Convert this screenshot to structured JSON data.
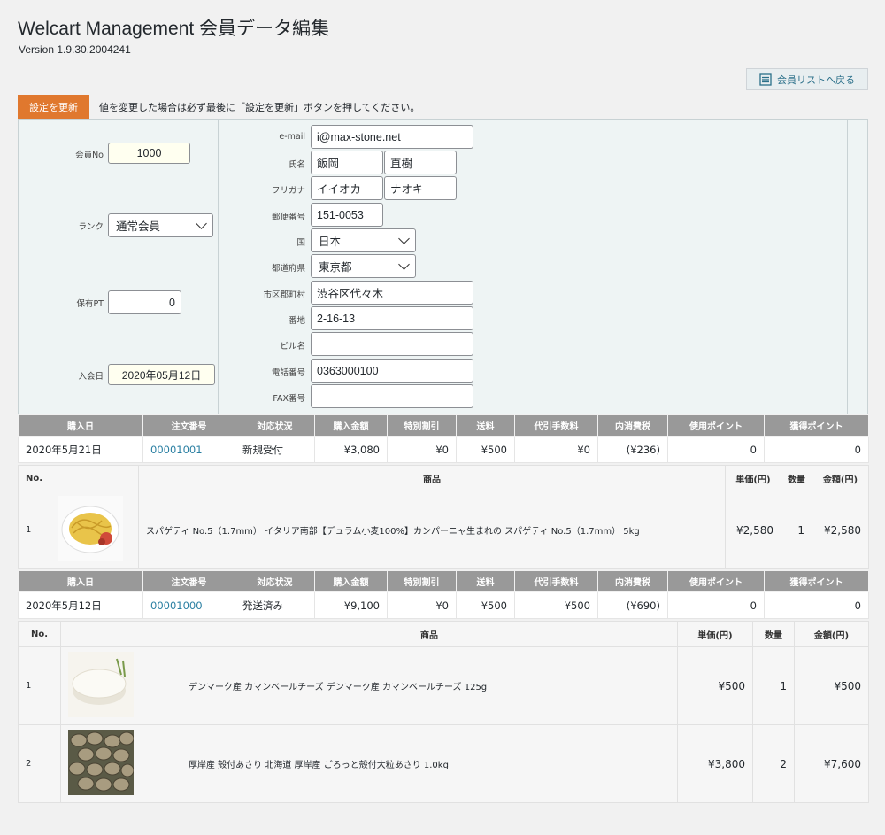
{
  "header": {
    "title": "Welcart Management 会員データ編集",
    "version": "Version 1.9.30.2004241",
    "back_label": "会員リストへ戻る",
    "update_label": "設定を更新",
    "notice": "値を変更した場合は必ず最後に「設定を更新」ボタンを押してください。"
  },
  "member": {
    "no_label": "会員No",
    "no": "1000",
    "rank_label": "ランク",
    "rank": "通常会員",
    "points_label": "保有PT",
    "points": "0",
    "joined_label": "入会日",
    "joined": "2020年05月12日",
    "email_label": "e-mail",
    "email": "i@max-stone.net",
    "name_label": "氏名",
    "last_name": "飯岡",
    "first_name": "直樹",
    "kana_label": "フリガナ",
    "last_kana": "イイオカ",
    "first_kana": "ナオキ",
    "zip_label": "郵便番号",
    "zip": "151-0053",
    "country_label": "国",
    "country": "日本",
    "pref_label": "都道府県",
    "pref": "東京都",
    "city_label": "市区郡町村",
    "city": "渋谷区代々木",
    "address_label": "番地",
    "address": "2-16-13",
    "building_label": "ビル名",
    "building": "",
    "tel_label": "電話番号",
    "tel": "0363000100",
    "fax_label": "FAX番号",
    "fax": ""
  },
  "order_headers": [
    "購入日",
    "注文番号",
    "対応状況",
    "購入金額",
    "特別割引",
    "送料",
    "代引手数料",
    "内消費税",
    "使用ポイント",
    "獲得ポイント"
  ],
  "item_headers": [
    "No.",
    "商品",
    "単価(円)",
    "数量",
    "金額(円)"
  ],
  "orders": [
    {
      "date": "2020年5月21日",
      "number": "00001001",
      "status": "新規受付",
      "amount": "¥3,080",
      "discount": "¥0",
      "shipping": "¥500",
      "cod": "¥0",
      "tax": "(¥236)",
      "used_points": "0",
      "earned_points": "0",
      "items": [
        {
          "no": "1",
          "image": "spaghetti-image",
          "name": "スパゲティ No.5（1.7mm） イタリア南部【デュラム小麦100%】カンパーニャ生まれの スパゲティ No.5（1.7mm） 5kg",
          "price": "¥2,580",
          "qty": "1",
          "total": "¥2,580"
        }
      ]
    },
    {
      "date": "2020年5月12日",
      "number": "00001000",
      "status": "発送済み",
      "amount": "¥9,100",
      "discount": "¥0",
      "shipping": "¥500",
      "cod": "¥500",
      "tax": "(¥690)",
      "used_points": "0",
      "earned_points": "0",
      "items": [
        {
          "no": "1",
          "image": "cheese-image",
          "name": "デンマーク産 カマンベールチーズ デンマーク産 カマンベールチーズ 125g",
          "price": "¥500",
          "qty": "1",
          "total": "¥500"
        },
        {
          "no": "2",
          "image": "clams-image",
          "name": "厚岸産 殻付あさり 北海道 厚岸産 ごろっと殻付大粒あさり 1.0kg",
          "price": "¥3,800",
          "qty": "2",
          "total": "¥7,600"
        }
      ]
    }
  ]
}
